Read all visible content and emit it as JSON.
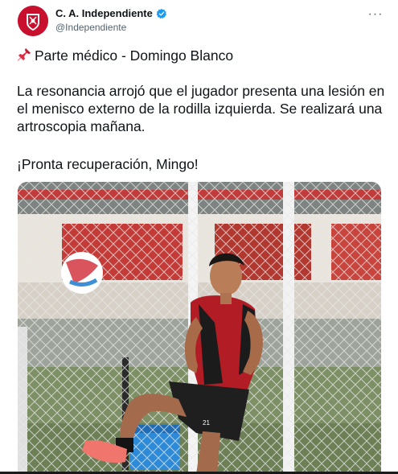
{
  "tweet": {
    "display_name": "C. A. Independiente",
    "handle": "@Independiente",
    "more_label": "···",
    "pin_icon": "pushpin-icon",
    "title": "Parte médico - Domingo Blanco",
    "body": "La resonancia arrojó que el jugador presenta una lesión en el menisco externo de la rodilla izquierda. Se realizará una artroscopia mañana.",
    "closing": "¡Pronta recuperación, Mingo!"
  },
  "photo": {
    "shirt_number": "21"
  },
  "colors": {
    "brand_red": "#c8102e",
    "verified_blue": "#1d9bf0",
    "text_primary": "#0f1419",
    "text_secondary": "#536471"
  }
}
